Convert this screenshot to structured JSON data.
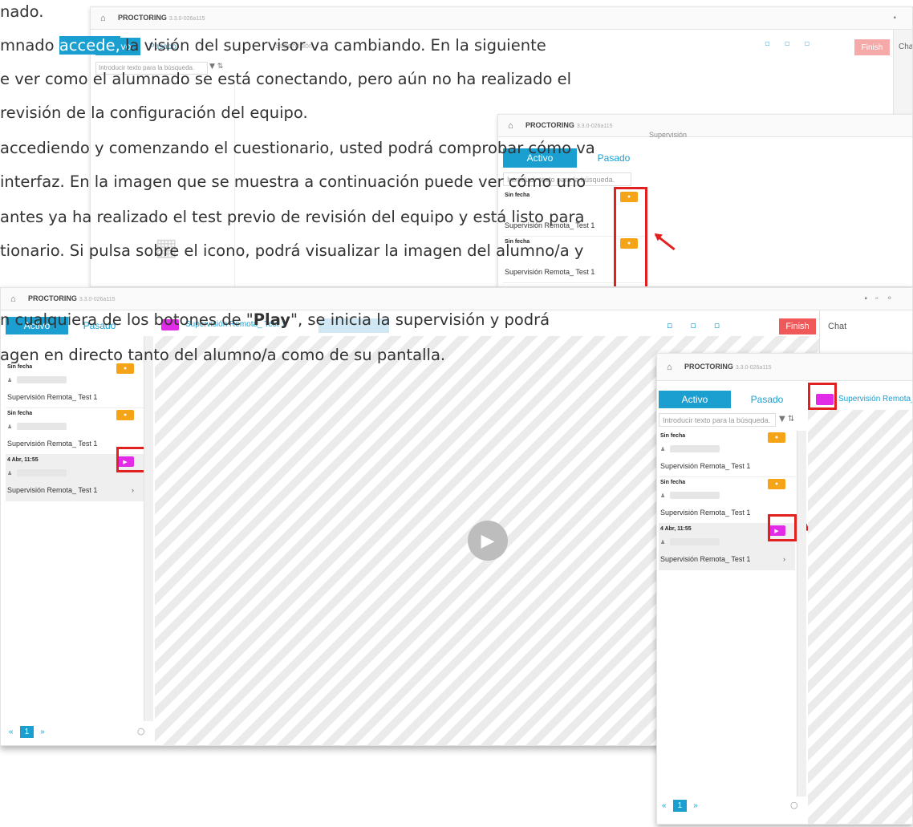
{
  "text": {
    "line1": "nado.",
    "line2_a": "mnado ",
    "line2_hl": "accede,",
    "line2_b": " la visión del supervisor va cambiando. En la siguiente",
    "line3": "e ver como el alumnado se está conectando, pero aún no ha realizado el",
    "line4": "revisión de la configuración del equipo.",
    "line5": "accediendo y comenzando el cuestionario, usted podrá comprobar cómo va",
    "line6": "interfaz. En la imagen que se muestra a continuación puede ver cómo uno",
    "line7": "antes ya ha realizado el test previo de revisión del equipo y está listo para",
    "line8": "tionario. Si pulsa sobre el icono, podrá visualizar la imagen del alumno/a y",
    "line9_a": "n cualquiera de los botones de \"",
    "line9_b": "Play",
    "line9_c": "\", se inicia la supervisión y podrá",
    "line10": "agen en directo tanto del alumno/a como de su pantalla."
  },
  "app": {
    "brand": "PROCTORING",
    "version": "3.3.0-026a115",
    "tab_active": "Activo",
    "tab_passive": "Pasado",
    "search_placeholder": "Introducir texto para la búsqueda.",
    "supervision_label": "Supervisión",
    "session_title": "Supervisión Remota_ Test 1",
    "finish_label": "Finish",
    "chat_label": "Chat",
    "chat_short": "Cha",
    "page_number": "1",
    "prev": "«",
    "next": "»"
  },
  "items": [
    {
      "date": "Sin fecha",
      "test": "Supervisión Remota_ Test 1",
      "badge": "orange",
      "badge_icon": "camera-icon"
    },
    {
      "date": "Sin fecha",
      "test": "Supervisión Remota_ Test 1",
      "badge": "orange",
      "badge_icon": "camera-icon"
    },
    {
      "date": "4 Abr, 11:55",
      "test": "Supervisión Remota_ Test 1",
      "badge": "magenta",
      "badge_icon": "play-icon"
    }
  ],
  "colors": {
    "primary": "#1a9fd0",
    "orange": "#f5a417",
    "magenta": "#e22be6",
    "finish": "#f0595a",
    "red_annotation": "#e12020"
  }
}
